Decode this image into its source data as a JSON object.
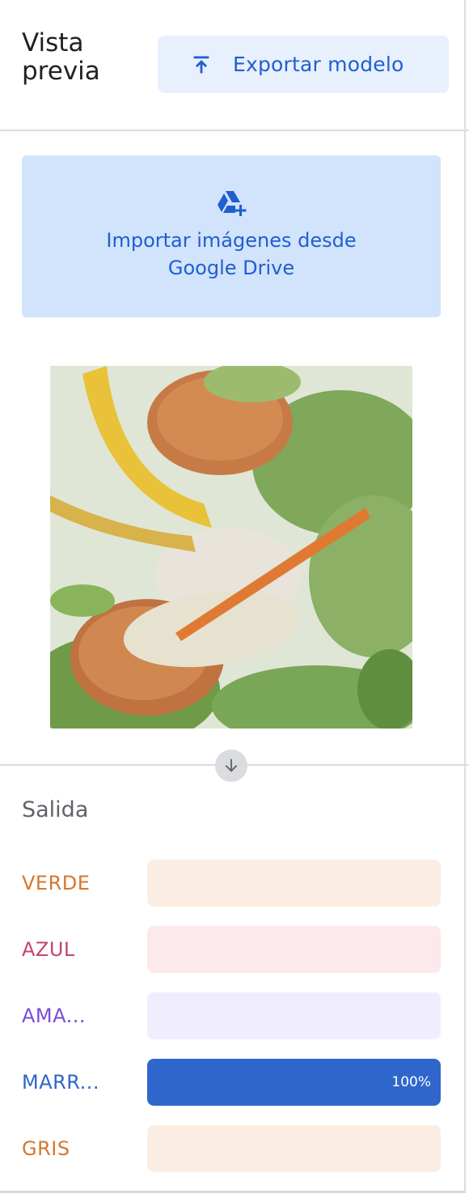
{
  "header": {
    "title": "Vista previa",
    "export_label": "Exportar modelo",
    "export_icon": "upload-icon"
  },
  "drive": {
    "label": "Importar imágenes desde Google Drive",
    "icon": "google-drive-add-icon"
  },
  "preview": {
    "image": "food-waste-image",
    "arrow_icon": "arrow-down-icon"
  },
  "output": {
    "title": "Salida",
    "classes": [
      {
        "label": "VERDE",
        "color": "#d9762b",
        "bar_bg": "#fbede3",
        "value": 0,
        "value_label": ""
      },
      {
        "label": "AZUL",
        "color": "#c2466b",
        "bar_bg": "#fbe9ec",
        "value": 0,
        "value_label": ""
      },
      {
        "label": "AMA...",
        "color": "#7b4bdb",
        "bar_bg": "#f0eefd",
        "value": 0,
        "value_label": ""
      },
      {
        "label": "MARR...",
        "color": "#2f66cc",
        "bar_bg": "#e8f0fe",
        "value": 1,
        "value_label": "100%"
      },
      {
        "label": "GRIS",
        "color": "#d9762b",
        "bar_bg": "#fbede3",
        "value": 0,
        "value_label": ""
      }
    ]
  }
}
